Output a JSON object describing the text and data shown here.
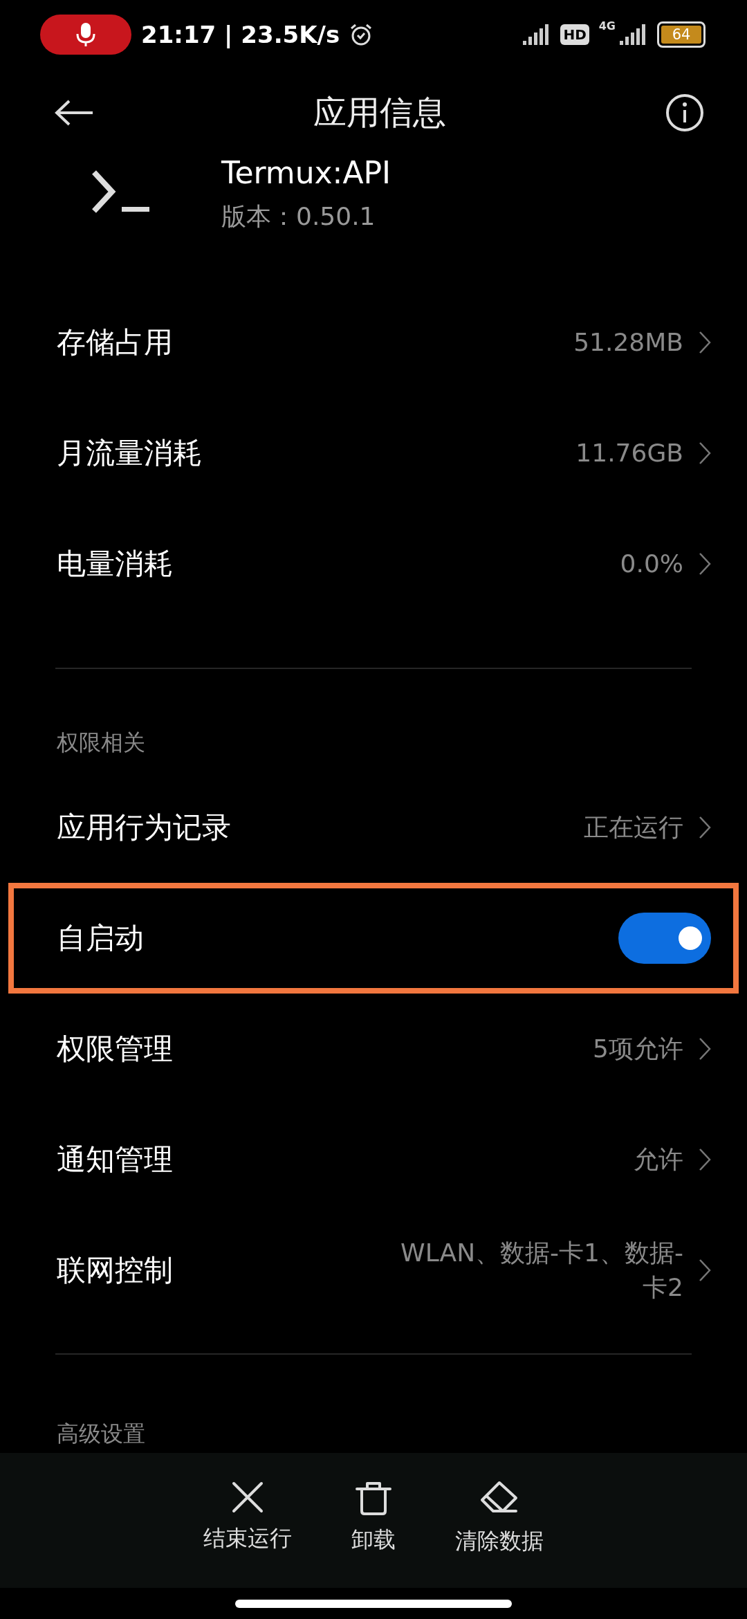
{
  "status_bar": {
    "recording": true,
    "time": "21:17 | 23.5K/s",
    "hd": "HD",
    "network": "4G",
    "battery": "64"
  },
  "header": {
    "title": "应用信息"
  },
  "app": {
    "name": "Termux:API",
    "version": "版本：0.50.1"
  },
  "usage_rows": [
    {
      "label": "存储占用",
      "value": "51.28MB"
    },
    {
      "label": "月流量消耗",
      "value": "11.76GB"
    },
    {
      "label": "电量消耗",
      "value": "0.0%"
    }
  ],
  "permissions": {
    "heading": "权限相关",
    "rows": [
      {
        "kind": "link",
        "label": "应用行为记录",
        "value": "正在运行",
        "highlighted": false
      },
      {
        "kind": "switch",
        "label": "自启动",
        "on": true,
        "highlighted": true
      },
      {
        "kind": "link",
        "label": "权限管理",
        "value": "5项允许",
        "highlighted": false
      },
      {
        "kind": "link",
        "label": "通知管理",
        "value": "允许",
        "highlighted": false
      },
      {
        "kind": "link",
        "label": "联网控制",
        "value": "WLAN、数据-卡1、数据-卡2",
        "highlighted": false
      }
    ]
  },
  "advanced": {
    "heading": "高级设置"
  },
  "bottom_actions": [
    {
      "kind": "stop",
      "label": "结束运行"
    },
    {
      "kind": "uninstall",
      "label": "卸载"
    },
    {
      "kind": "clear",
      "label": "清除数据"
    }
  ]
}
